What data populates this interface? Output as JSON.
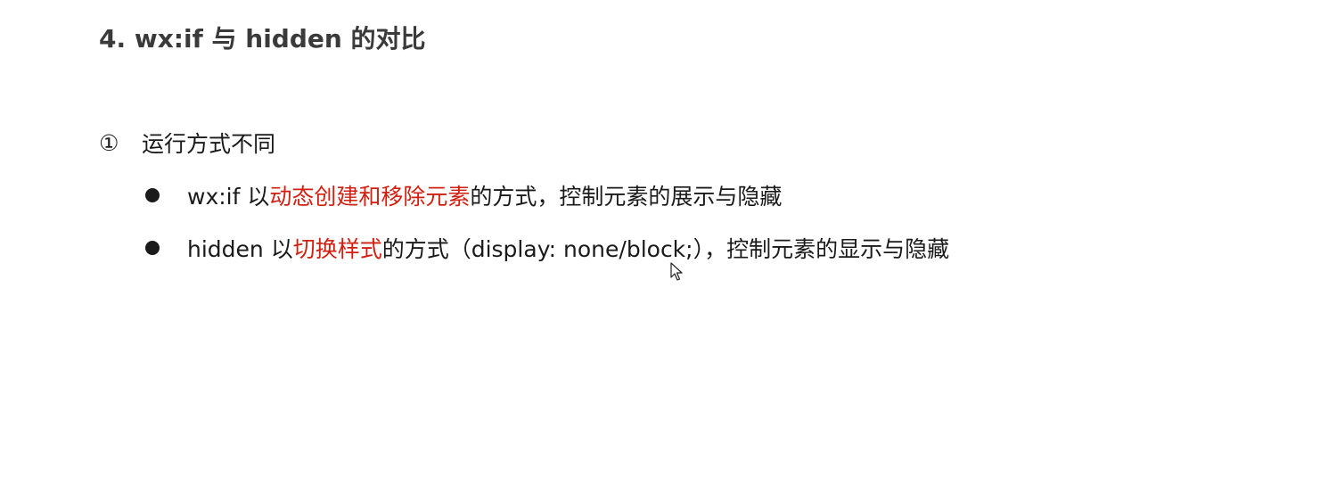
{
  "title": "4. wx:if 与 hidden 的对比",
  "section": {
    "number": "①",
    "heading": "运行方式不同"
  },
  "bullets": [
    {
      "prefix": "wx:if 以",
      "highlight": "动态创建和移除元素",
      "suffix": "的方式，控制元素的展示与隐藏"
    },
    {
      "prefix": "hidden 以",
      "highlight": "切换样式",
      "suffix": "的方式（display: none/block;），控制元素的显示与隐藏"
    }
  ],
  "colors": {
    "highlight": "#d21f10",
    "title": "#3a3a3a",
    "text": "#1a1a1a"
  },
  "icons": {
    "bullet": "filled-circle",
    "cursor": "mouse-pointer-icon"
  }
}
